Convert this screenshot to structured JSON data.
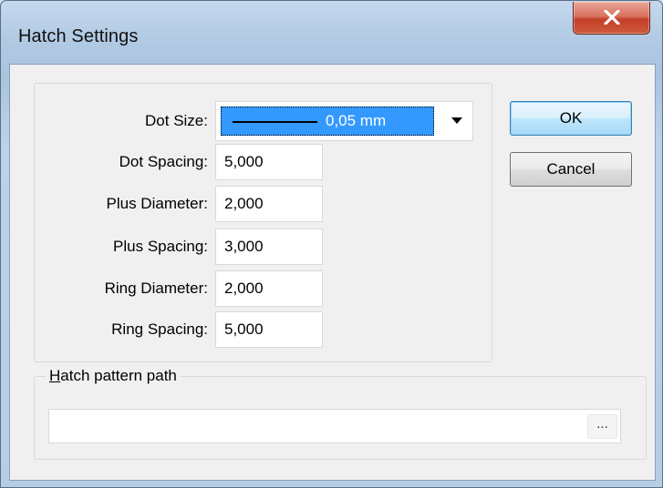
{
  "window": {
    "title": "Hatch Settings"
  },
  "fields": {
    "dot_size": {
      "label": "Dot Size:",
      "value": "0,05 mm"
    },
    "dot_spacing": {
      "label": "Dot Spacing:",
      "value": "5,000"
    },
    "plus_diameter": {
      "label": "Plus Diameter:",
      "value": "2,000"
    },
    "plus_spacing": {
      "label": "Plus Spacing:",
      "value": "3,000"
    },
    "ring_diameter": {
      "label": "Ring Diameter:",
      "value": "2,000"
    },
    "ring_spacing": {
      "label": "Ring Spacing:",
      "value": "5,000"
    }
  },
  "buttons": {
    "ok": "OK",
    "cancel": "Cancel"
  },
  "hatch_path": {
    "legend_accel": "H",
    "legend_rest": "atch pattern path",
    "value": "",
    "browse_label": "..."
  },
  "colors": {
    "selection": "#3399ff",
    "close_button": "#c33f27",
    "default_button": "#3c7fb1"
  },
  "icons": [
    "close-icon",
    "dropdown-arrow-icon"
  ]
}
